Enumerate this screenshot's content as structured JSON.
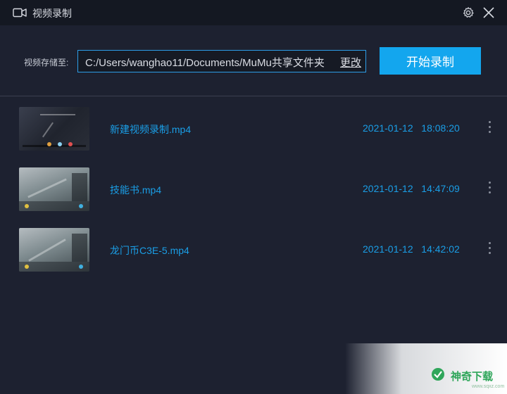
{
  "window": {
    "title": "视频录制",
    "title_icon": "video-camera-icon",
    "settings_icon": "gear-icon",
    "close_icon": "close-icon"
  },
  "save": {
    "label": "视频存储至:",
    "path": "C:/Users/wanghao11/Documents/MuMu共享文件夹",
    "change_label": "更改"
  },
  "start_button": {
    "label": "开始录制",
    "color": "#13a6ee"
  },
  "recordings": [
    {
      "name": "新建视频录制.mp4",
      "date": "2021-01-12",
      "time": "18:08:20",
      "thumb": "desktop"
    },
    {
      "name": "技能书.mp4",
      "date": "2021-01-12",
      "time": "14:47:09",
      "thumb": "game"
    },
    {
      "name": "龙门币C3E-5.mp4",
      "date": "2021-01-12",
      "time": "14:42:02",
      "thumb": "game"
    }
  ],
  "watermark": {
    "text": "神奇下载",
    "sub": "www.sqxz.com"
  },
  "colors": {
    "accent": "#1a9ee6",
    "background": "#1d2130",
    "titlebar": "#141822"
  }
}
